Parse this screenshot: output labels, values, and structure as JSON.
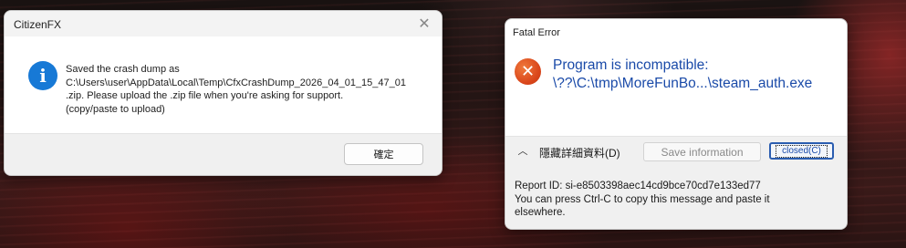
{
  "citizenfx_dialog": {
    "title": "CitizenFX",
    "close_glyph": "✕",
    "icon": "info-icon",
    "icon_glyph": "i",
    "message_lines": [
      "Saved the crash dump as",
      "C:\\Users\\user\\AppData\\Local\\Temp\\CfxCrashDump_2026_04_01_15_47_01",
      ".zip. Please upload the .zip file when you're asking for support.",
      "(copy/paste to upload)"
    ],
    "ok_label": "確定"
  },
  "fatal_error_dialog": {
    "title": "Fatal Error",
    "icon": "error-icon",
    "icon_glyph": "✕",
    "heading_lines": [
      "Program is incompatible:",
      "\\??\\C:\\tmp\\MoreFunBo...\\steam_auth.exe"
    ],
    "chevron_glyph": "︿",
    "hide_details_label": "隱藏詳細資料(D)",
    "save_label": "Save information",
    "closed_label": "closed(C)",
    "details_lines": [
      "Report ID: si-e8503398aec14cd9bce70cd7e133ed77",
      "You can press Ctrl-C to copy this message and paste it",
      "elsewhere."
    ]
  },
  "colors": {
    "info_accent": "#1779d6",
    "error_accent": "#d9451a",
    "heading_text": "#1a4aa8"
  }
}
